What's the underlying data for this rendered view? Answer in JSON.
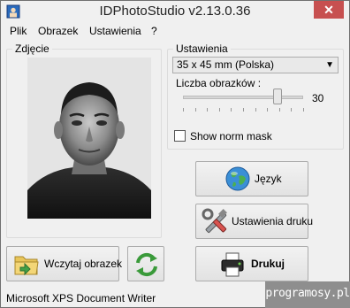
{
  "window": {
    "title": "IDPhotoStudio v2.13.0.36",
    "close_glyph": "✕"
  },
  "menu": {
    "items": [
      "Plik",
      "Obrazek",
      "Ustawienia",
      "?"
    ]
  },
  "photo_group": {
    "label": "Zdjęcie"
  },
  "settings_group": {
    "label": "Ustawienia",
    "format_selected": "35 x 45 mm (Polska)",
    "count_label": "Liczba obrazków :",
    "count_value": "30",
    "count_level_fraction": 0.79,
    "norm_mask_label": "Show norm mask",
    "norm_mask_checked": false
  },
  "buttons": {
    "language": "Język",
    "print_settings": "Ustawienia druku",
    "print": "Drukuj",
    "load_image": "Wczytaj obrazek"
  },
  "status": {
    "printer": "Microsoft XPS Document Writer"
  },
  "badge": {
    "text": "programosy.pl"
  },
  "icons": {
    "app": "app-icon",
    "language": "globe-icon",
    "print_settings": "tools-icon",
    "print": "printer-icon",
    "load_image": "folder-icon",
    "refresh": "refresh-icon",
    "dropdown": "chevron-down-icon"
  }
}
